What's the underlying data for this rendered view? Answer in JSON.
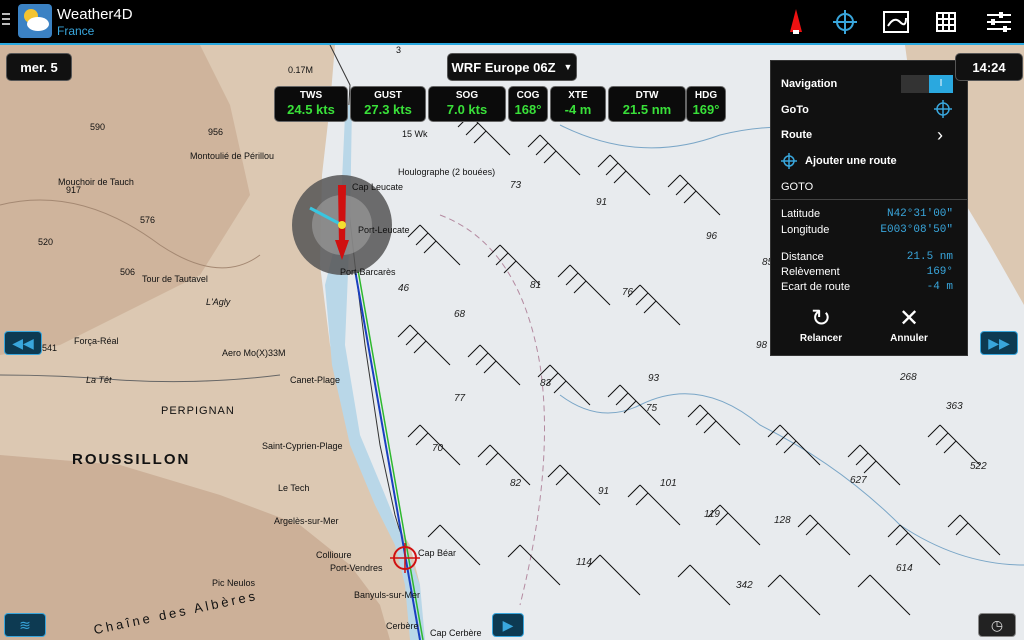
{
  "app": {
    "title": "Weather4D",
    "subtitle": "France"
  },
  "toolbar": {
    "icons": [
      "boat-icon",
      "target-icon",
      "map-icon",
      "grid-icon",
      "sliders-icon"
    ]
  },
  "date_pill": "mer. 5",
  "model_select": "WRF Europe 06Z",
  "clock": "14:24",
  "stats": [
    {
      "label": "TWS",
      "value": "24.5 kts"
    },
    {
      "label": "GUST",
      "value": "27.3 kts"
    },
    {
      "label": "SOG",
      "value": "7.0 kts"
    },
    {
      "label": "COG",
      "value": "168°"
    },
    {
      "label": "XTE",
      "value": "-4 m"
    },
    {
      "label": "DTW",
      "value": "21.5 nm"
    },
    {
      "label": "HDG",
      "value": "169°"
    }
  ],
  "panel": {
    "navigation": "Navigation",
    "toggle": "I",
    "goto": "GoTo",
    "route": "Route",
    "add_route": "Ajouter une route",
    "section": "GOTO",
    "latitude_label": "Latitude",
    "latitude": "N42°31'00\"",
    "longitude_label": "Longitude",
    "longitude": "E003°08'50\"",
    "distance_label": "Distance",
    "distance": "21.5 nm",
    "bearing_label": "Relèvement",
    "bearing": "169°",
    "xte_label": "Ecart de route",
    "xte": "-4 m",
    "restart": "Relancer",
    "cancel": "Annuler"
  },
  "map": {
    "places": [
      "ROUSSILLON",
      "PERPIGNAN",
      "Aero Mo(X)33M",
      "Tour de Tautavel",
      "Montoulié de Périllou",
      "Canet-Plage",
      "Saint-Cyprien-Plage",
      "Le Tech",
      "Argelès-sur-Mer",
      "Collioure",
      "Port-Vendres",
      "Banyuls-sur-Mer",
      "Cerbère",
      "Cap Cerbère",
      "Cap Béar",
      "Cap Leucate",
      "Port-Barcarès",
      "Port-Leucate",
      "Houlographe (2 bouées)",
      "Chaîne des Albères",
      "Força-Réal",
      "Pic Neulos",
      "L'Agly",
      "La Têt",
      "Mouchoir de Tauch"
    ],
    "wind_numbers": [
      "73",
      "91",
      "76",
      "85",
      "96",
      "98",
      "46",
      "68",
      "81",
      "83",
      "77",
      "70",
      "82",
      "91",
      "101",
      "114",
      "119",
      "128",
      "268",
      "363",
      "522",
      "627",
      "614",
      "342",
      "93",
      "75"
    ],
    "terrain_numbers": [
      "590",
      "956",
      "917",
      "576",
      "520",
      "506",
      "541",
      "0.17M",
      "15 Wk",
      "3"
    ]
  }
}
